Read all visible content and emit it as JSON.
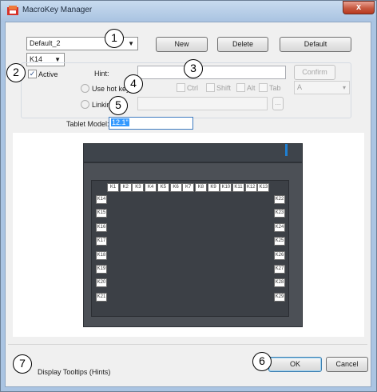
{
  "window": {
    "title": "MacroKey Manager",
    "close_label": "x"
  },
  "profile": {
    "selected": "Default_2"
  },
  "buttons": {
    "new": "New",
    "delete": "Delete",
    "default": "Default",
    "confirm": "Confirm",
    "browse": "...",
    "ok": "OK",
    "cancel": "Cancel"
  },
  "key_select": {
    "selected": "K14"
  },
  "active": {
    "label": "Active",
    "checked": true
  },
  "hint": {
    "label": "Hint:",
    "value": ""
  },
  "hotkey": {
    "label": "Use hot key",
    "ctrl": "Ctrl",
    "shift": "Shift",
    "alt": "Alt",
    "tab": "Tab",
    "key_value": "A"
  },
  "linking": {
    "label": "Linking",
    "value": ""
  },
  "tablet_model": {
    "label": "Tablet Model:",
    "value": "12.1\""
  },
  "tablet_keys": {
    "top": [
      "K1",
      "K2",
      "K3",
      "K4",
      "K5",
      "K6",
      "K7",
      "K8",
      "K9",
      "K10",
      "K11",
      "K12",
      "K13"
    ],
    "left": [
      "K14",
      "K15",
      "K16",
      "K17",
      "K18",
      "K19",
      "K20",
      "K21"
    ],
    "right": [
      "K22",
      "K23",
      "K24",
      "K25",
      "K26",
      "K27",
      "K28",
      "K29"
    ]
  },
  "tooltips": {
    "label": "Display Tooltips (Hints)"
  },
  "callouts": [
    "1",
    "2",
    "3",
    "4",
    "5",
    "6",
    "7"
  ],
  "colors": {
    "tablet_bezel": "#4c5056",
    "tablet_led": "#1e7fd2",
    "selection": "#3399ff"
  }
}
